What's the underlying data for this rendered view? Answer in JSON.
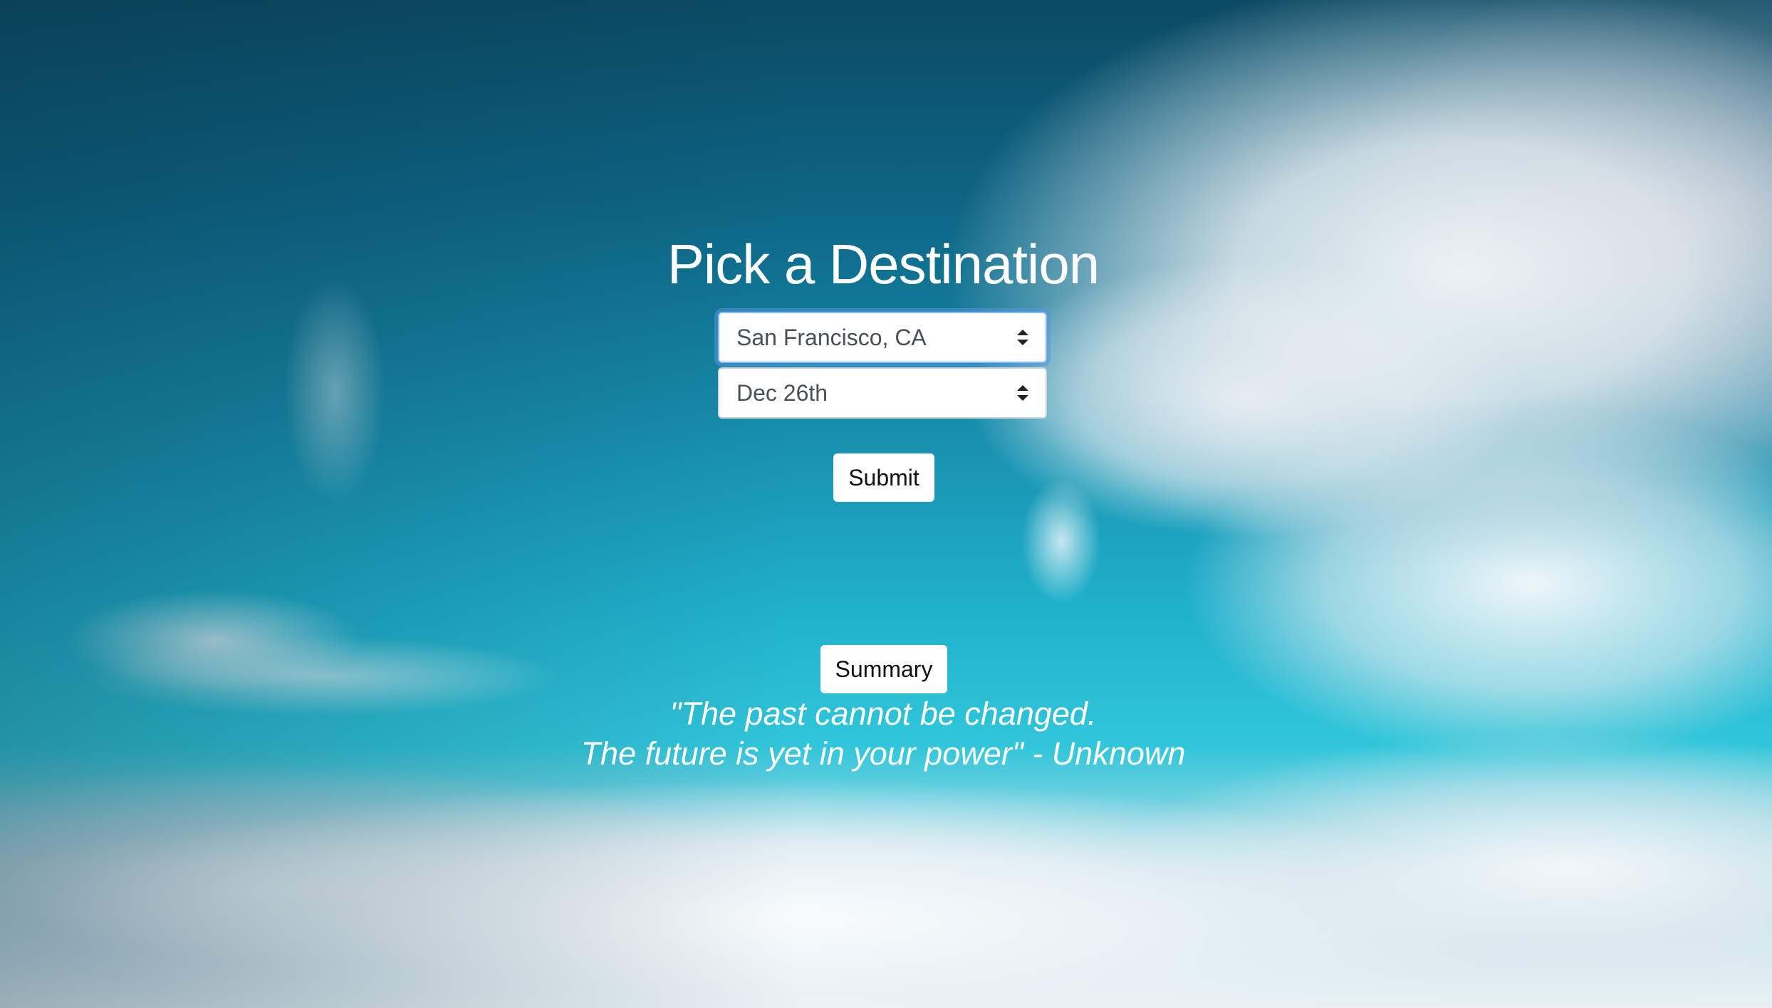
{
  "page": {
    "title": "Pick a Destination"
  },
  "form": {
    "destination": {
      "selected": "San Francisco, CA"
    },
    "date": {
      "selected": "Dec 26th"
    },
    "submit_label": "Submit"
  },
  "summary_label": "Summary",
  "quote": {
    "line1": "\"The past cannot be changed.",
    "line2": "The future is yet in your power\" - Unknown"
  },
  "colors": {
    "focus_ring": "#80bdff",
    "select_text": "#495057",
    "title_text": "#ffffff"
  },
  "icons": {
    "select_arrow": "updown-arrow-icon"
  }
}
